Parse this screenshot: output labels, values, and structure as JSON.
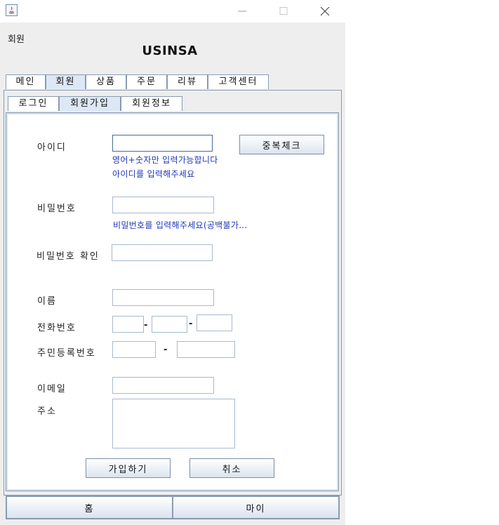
{
  "window": {
    "title": "",
    "controls": [
      "minimize-icon",
      "maximize-icon",
      "close-icon"
    ]
  },
  "frame_title": "회원",
  "brand": "USINSA",
  "main_tabs": [
    {
      "label": "메인",
      "selected": false
    },
    {
      "label": "회원",
      "selected": true
    },
    {
      "label": "상품",
      "selected": false
    },
    {
      "label": "주문",
      "selected": false
    },
    {
      "label": "리뷰",
      "selected": false
    },
    {
      "label": "고객센터",
      "selected": false
    }
  ],
  "sub_tabs": [
    {
      "label": "로그인",
      "selected": false
    },
    {
      "label": "회원가입",
      "selected": true
    },
    {
      "label": "회원정보",
      "selected": false
    }
  ],
  "form": {
    "id_label": "아이디",
    "id_value": "",
    "dup_check_button": "중복체크",
    "id_hint_1": "영어+숫자만 입력가능합니다",
    "id_hint_2": "아이디를 입력해주세요",
    "pw_label": "비밀번호",
    "pw_value": "",
    "pw_hint": "비밀번호를 입력해주세요(공백불가...",
    "pw_confirm_label": "비밀번호 확인",
    "pw_confirm_value": "",
    "name_label": "이름",
    "name_value": "",
    "phone_label": "전화번호",
    "phone_sep": "-",
    "rrn_label": "주민등록번호",
    "rrn_sep": "-",
    "email_label": "이메일",
    "email_value": "",
    "address_label": "주소",
    "address_value": "",
    "signup_button": "가입하기",
    "cancel_button": "취소"
  },
  "bottom_nav": {
    "home": "홈",
    "my": "마이"
  },
  "colors": {
    "hint_text": "#1f36b8",
    "selected_tab": "#dde8f6",
    "border": "#8a9bb1"
  }
}
